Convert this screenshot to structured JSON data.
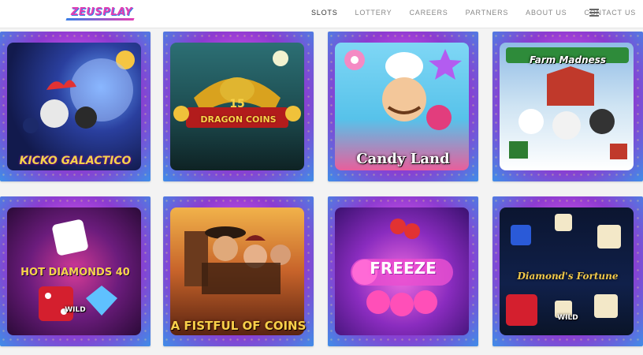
{
  "header": {
    "logo_text": "ZEUSPLAY",
    "nav": [
      {
        "label": "SLOTS",
        "active": true
      },
      {
        "label": "LOTTERY",
        "active": false
      },
      {
        "label": "CAREERS",
        "active": false
      },
      {
        "label": "PARTNERS",
        "active": false
      },
      {
        "label": "ABOUT US",
        "active": false
      },
      {
        "label": "CONTACT US",
        "active": false
      }
    ],
    "menu_icon": "hamburger-icon"
  },
  "games": [
    {
      "title": "KICKO GALACTICO"
    },
    {
      "title": "DRAGON COINS",
      "badge": "15"
    },
    {
      "title": "Candy Land"
    },
    {
      "title": "Farm Madness"
    },
    {
      "title": "HOT DIAMONDS 40",
      "badge": "WILD"
    },
    {
      "title": "A FISTFUL OF COINS"
    },
    {
      "title": "FREEZE"
    },
    {
      "title": "Diamond's Fortune",
      "badge": "WILD"
    }
  ],
  "colors": {
    "accent": "#e23fb4",
    "secondary": "#3b7ee6",
    "tile_bg": "#c04ae0"
  }
}
